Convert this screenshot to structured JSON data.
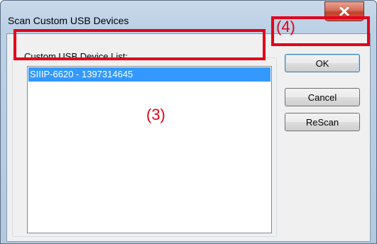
{
  "window": {
    "title": "Scan Custom USB Devices",
    "close_icon": "close-x-icon"
  },
  "group": {
    "label": "Custom USB Device List:"
  },
  "device_list": {
    "items": [
      {
        "label": "SIIIP-6620 - 1397314645",
        "selected": true
      }
    ]
  },
  "buttons": {
    "ok": "OK",
    "cancel": "Cancel",
    "rescan": "ReScan"
  },
  "annotations": {
    "list_marker": "(3)",
    "ok_marker": "(4)",
    "color": "#e3001b"
  },
  "colors": {
    "selection": "#3399ff",
    "close_button": "#c0412b"
  }
}
